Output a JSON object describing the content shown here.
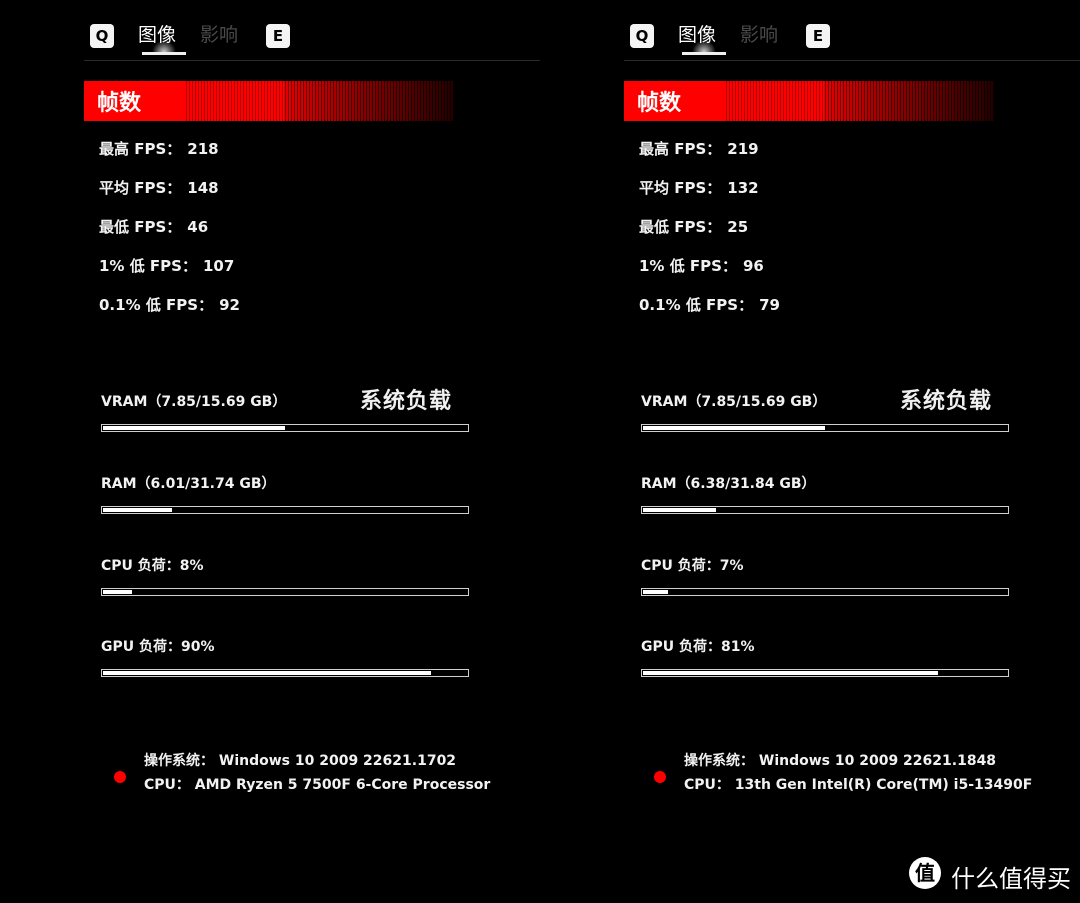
{
  "panels": [
    {
      "tabs": {
        "prev_key": "Q",
        "next_key": "E",
        "active": "图像",
        "inactive": "影响"
      },
      "fps_section_title": "帧数",
      "fps": [
        {
          "label": "最高 FPS：",
          "value": "218"
        },
        {
          "label": "平均 FPS：",
          "value": "148"
        },
        {
          "label": "最低 FPS：",
          "value": "46"
        },
        {
          "label": "1% 低 FPS：",
          "value": "107"
        },
        {
          "label": "0.1% 低 FPS：",
          "value": "92"
        }
      ],
      "load_section_title": "系统负载",
      "metrics": [
        {
          "label": "VRAM（7.85/15.69 GB）",
          "fill_percent": 50
        },
        {
          "label": "RAM（6.01/31.74 GB）",
          "fill_percent": 19
        },
        {
          "label": "CPU 负荷：8%",
          "fill_percent": 8
        },
        {
          "label": "GPU 负荷：90%",
          "fill_percent": 90
        }
      ],
      "system": {
        "os": "操作系统： Windows 10 2009 22621.1702",
        "cpu": "CPU： AMD Ryzen 5 7500F 6-Core Processor"
      }
    },
    {
      "tabs": {
        "prev_key": "Q",
        "next_key": "E",
        "active": "图像",
        "inactive": "影响"
      },
      "fps_section_title": "帧数",
      "fps": [
        {
          "label": "最高 FPS：",
          "value": "219"
        },
        {
          "label": "平均 FPS：",
          "value": "132"
        },
        {
          "label": "最低 FPS：",
          "value": "25"
        },
        {
          "label": "1% 低 FPS：",
          "value": "96"
        },
        {
          "label": "0.1% 低 FPS：",
          "value": "79"
        }
      ],
      "load_section_title": "系统负载",
      "metrics": [
        {
          "label": "VRAM（7.85/15.69 GB）",
          "fill_percent": 50
        },
        {
          "label": "RAM（6.38/31.84 GB）",
          "fill_percent": 20
        },
        {
          "label": "CPU 负荷：7%",
          "fill_percent": 7
        },
        {
          "label": "GPU 负荷：81%",
          "fill_percent": 81
        }
      ],
      "system": {
        "os": "操作系统： Windows 10 2009 22621.1848",
        "cpu": "CPU： 13th Gen Intel(R) Core(TM) i5-13490F"
      }
    }
  ],
  "watermark": {
    "badge": "值",
    "text": "什么值得买"
  },
  "colors": {
    "accent_red": "#ff0000",
    "background": "#000000",
    "text": "#f2f2f2"
  }
}
